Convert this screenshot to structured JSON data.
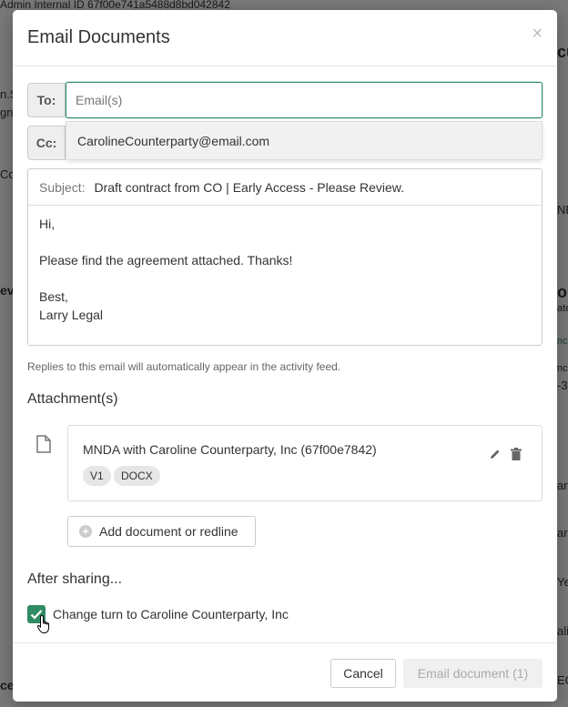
{
  "background": {
    "admin_id": "Admin Internal ID 67f00e741a5488d8bd042842",
    "fragments": [
      "n.S",
      "gn",
      "Co",
      "ev",
      "cu",
      "NE",
      "op",
      "ate",
      "nc",
      "nc",
      "-3",
      "ard",
      "ard",
      "Ye",
      "alif",
      "EC",
      "ce"
    ]
  },
  "modal": {
    "title": "Email Documents",
    "close_glyph": "×",
    "to_label": "To:",
    "to_placeholder": "Email(s)",
    "to_value": "",
    "cc_label": "Cc:",
    "suggestion": "CarolineCounterparty@email.com",
    "subject_label": "Subject:",
    "subject_value": "Draft contract from CO | Early Access - Please Review.",
    "body_lines": [
      "Hi,",
      "",
      "Please find the agreement attached. Thanks!",
      "",
      "Best,",
      "Larry Legal"
    ],
    "help_text": "Replies to this email will automatically appear in the activity feed.",
    "attachments_title": "Attachment(s)",
    "attachment": {
      "name": "MNDA with Caroline Counterparty, Inc (67f00e7842)",
      "tags": [
        "V1",
        "DOCX"
      ],
      "icon": "file-icon"
    },
    "add_document_label": "Add document or redline",
    "after_sharing_title": "After sharing...",
    "change_turn_label": "Change turn to Caroline Counterparty, Inc",
    "change_turn_checked": true,
    "cancel_label": "Cancel",
    "send_label": "Email document (1)"
  },
  "colors": {
    "accent": "#2e8b62",
    "overlay": "rgba(0,0,0,0.5)"
  }
}
